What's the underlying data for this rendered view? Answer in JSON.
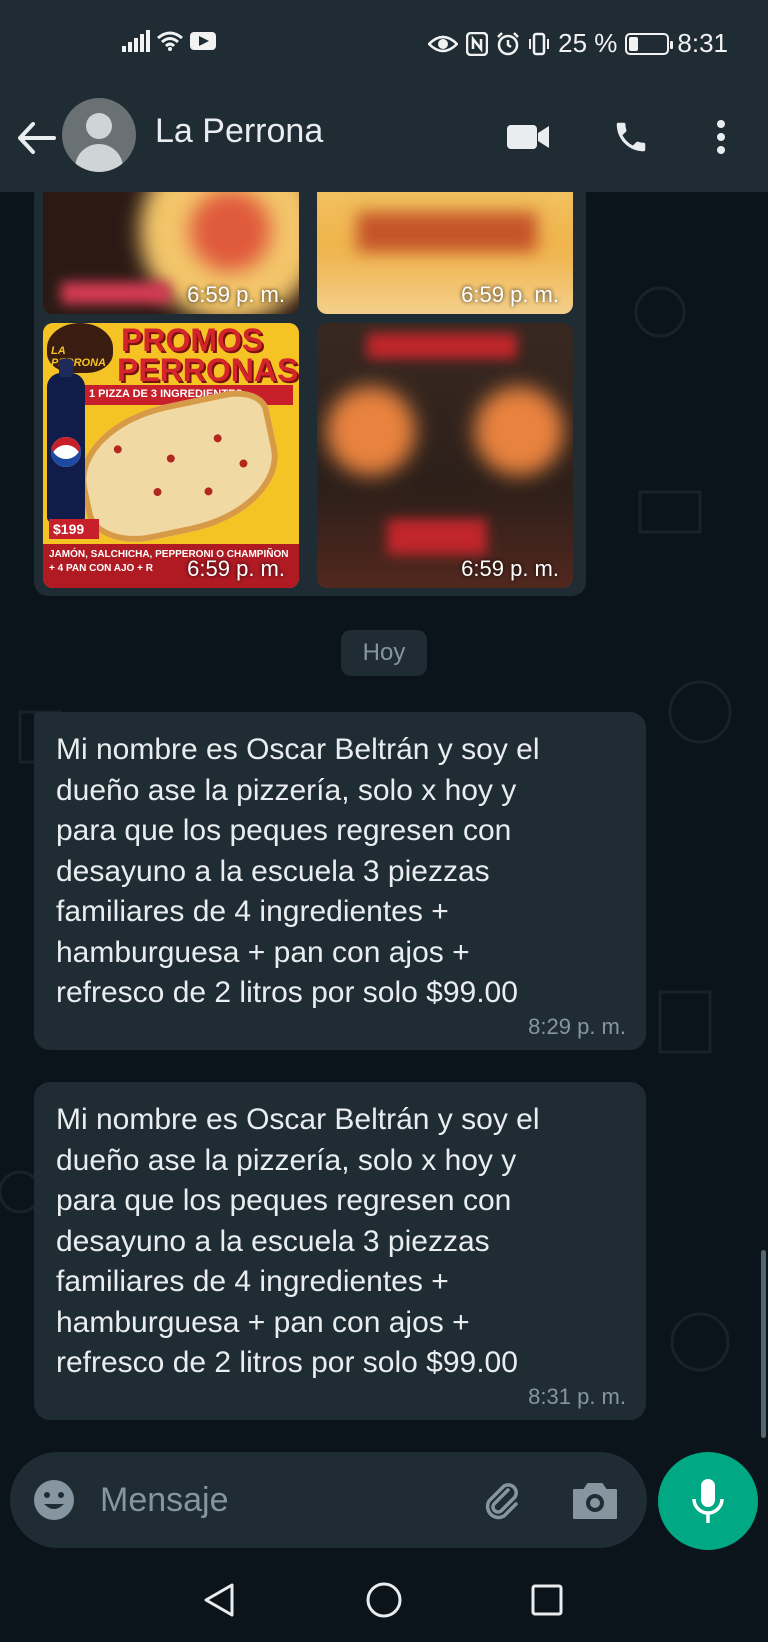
{
  "status_bar": {
    "battery_percent": "25 %",
    "battery_level": 0.25,
    "time": "8:31"
  },
  "header": {
    "contact_name": "La Perrona",
    "icons": [
      "back-arrow-icon",
      "avatar",
      "video-call-icon",
      "phone-call-icon",
      "more-options-icon"
    ]
  },
  "media": {
    "timestamps": [
      "6:59 p. m.",
      "6:59 p. m.",
      "6:59 p. m.",
      "6:59 p. m."
    ],
    "promo": {
      "title_line1": "PROMOS",
      "title_line2": "PERRONAS",
      "logo_text": "LA PERRONA",
      "subtitle": "1 PIZZA DE 3 INGREDIENTES",
      "price": "$199",
      "footer_line1": "JAMÓN, SALCHICHA, PEPPERONI O CHAMPIÑON",
      "footer_line2": "+ 4 PAN CON AJO + R"
    }
  },
  "date_divider": "Hoy",
  "messages": [
    {
      "text": "Mi nombre es Oscar Beltrán y soy el\ndueño ase la pizzería, solo x hoy y\npara que los peques regresen con\ndesayuno a la escuela 3 piezzas\nfamiliares de 4 ingredientes +\nhamburguesa + pan con ajos +\nrefresco de 2 litros por solo $99.00",
      "time": "8:29 p. m."
    },
    {
      "text": "Mi nombre es Oscar Beltrán y soy el\ndueño ase la pizzería, solo x hoy y\npara que los peques regresen con\ndesayuno a la escuela 3 piezzas\nfamiliares de 4 ingredientes +\nhamburguesa + pan con ajos +\nrefresco de 2 litros por solo $99.00",
      "time": "8:31 p. m."
    }
  ],
  "composer": {
    "placeholder": "Mensaje"
  },
  "colors": {
    "background": "#0b141a",
    "bar": "#1f2c34",
    "bubble": "#1f2c34",
    "accent": "#00a884",
    "text": "#e9edef",
    "meta": "#8696a0"
  }
}
